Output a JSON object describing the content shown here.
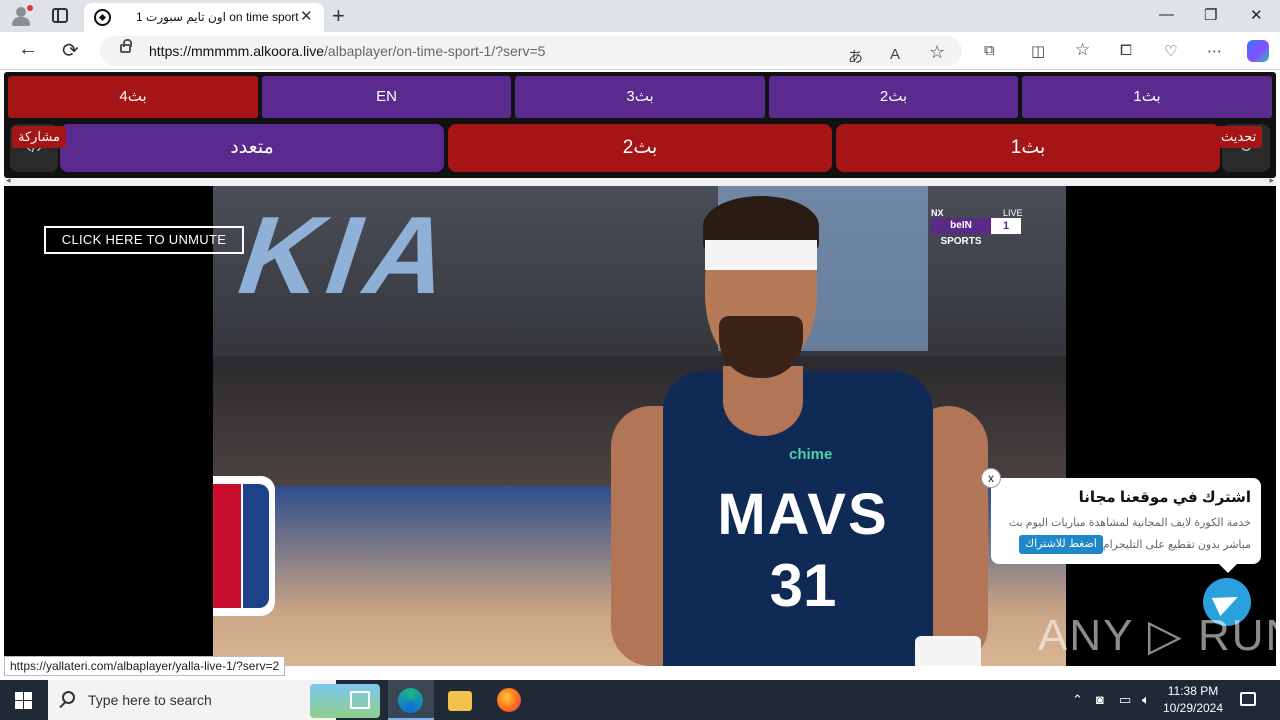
{
  "browser": {
    "tab_title": "اون تايم سبورت 1 on time sport",
    "tab_close": "✕",
    "new_tab": "+",
    "window_controls": {
      "minimize": "—",
      "maximize": "❐",
      "close": "✕"
    },
    "url_host": "https://mmmmm.alkoora.live",
    "url_path": "/albaplayer/on-time-sport-1/?serv=5",
    "icons": [
      "back-icon",
      "refresh-icon",
      "lock-icon",
      "translate-icon",
      "read-aloud-icon",
      "favorite-star-icon",
      "extensions-icon",
      "split-screen-icon",
      "favorites-icon",
      "collections-icon",
      "browser-essentials-icon",
      "more-icon",
      "copilot-icon"
    ]
  },
  "page": {
    "servers_row1": [
      {
        "label": "بث4",
        "color": "#a51515"
      },
      {
        "label": "EN",
        "color": "#5a2a8f"
      },
      {
        "label": "بث3",
        "color": "#5a2a8f"
      },
      {
        "label": "بث2",
        "color": "#5a2a8f"
      },
      {
        "label": "بث1",
        "color": "#5a2a8f"
      }
    ],
    "servers_row2": [
      {
        "label": "متعدد",
        "color": "#5a2a8f"
      },
      {
        "label": "بث2",
        "color": "#a51515"
      },
      {
        "label": "بث1",
        "color": "#a51515"
      }
    ],
    "share_label": "مشاركة",
    "refresh_label": "تحديث",
    "unmute_label": "CLICK HERE TO UNMUTE",
    "video_overlay": {
      "channel_logo_text": "beIN SPORTS",
      "channel_number": "1",
      "channel_live": "LIVE",
      "channel_badge": "NX",
      "jersey_text": "MAVS",
      "jersey_number": "31",
      "sponsor": "chime",
      "arena_banner": "KIA"
    },
    "popup": {
      "title": "اشترك في موقعنا مجانا",
      "line1": "خدمة الكورة لايف المجانية لمشاهدة مباريات اليوم بث",
      "line2": "مباشر بدون تقطيع على التليجرام",
      "button": "اضغط للاشتراك",
      "close": "x"
    },
    "watermark": "ANY ▷ RUN",
    "status_url": "https://yallateri.com/albaplayer/yalla-live-1/?serv=2"
  },
  "taskbar": {
    "search_placeholder": "Type here to search",
    "time": "11:38 PM",
    "date": "10/29/2024",
    "tray_icons": [
      "chevron-up-icon",
      "meet-icon",
      "network-icon",
      "volume-icon"
    ]
  }
}
